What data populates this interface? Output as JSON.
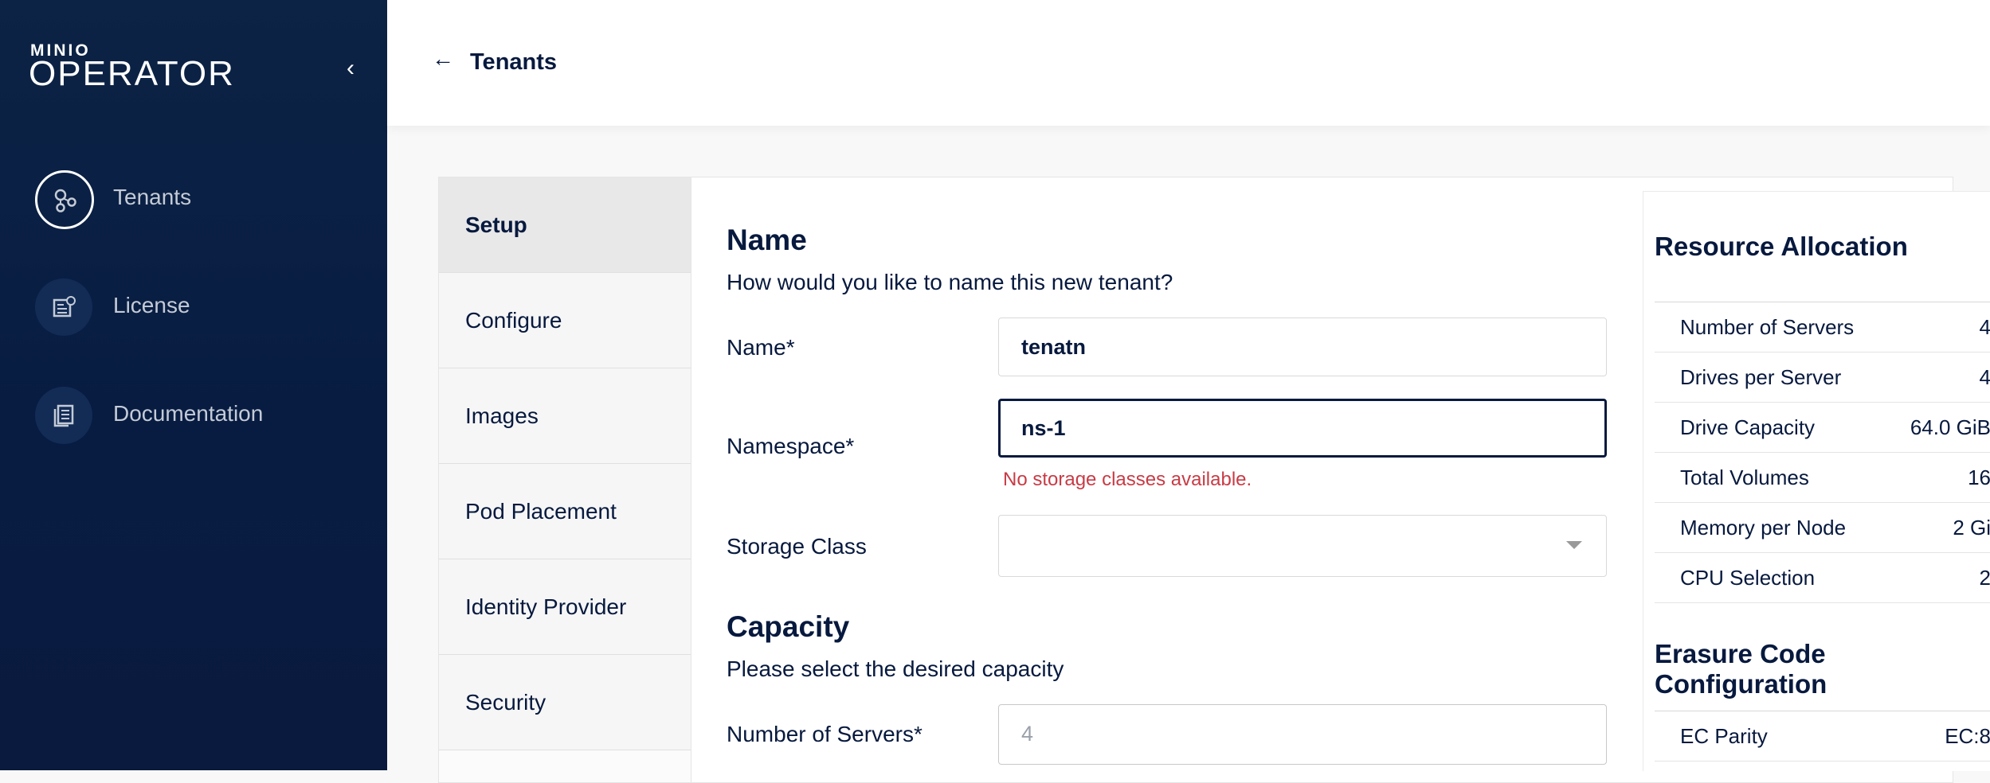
{
  "sidebar": {
    "logo_top": "MINIO",
    "logo_main": "OPERATOR",
    "items": [
      {
        "label": "Tenants",
        "icon": "tenants-icon"
      },
      {
        "label": "License",
        "icon": "license-icon"
      },
      {
        "label": "Documentation",
        "icon": "documentation-icon"
      }
    ]
  },
  "header": {
    "back_label": "Tenants"
  },
  "steps": [
    "Setup",
    "Configure",
    "Images",
    "Pod Placement",
    "Identity Provider",
    "Security"
  ],
  "name_section": {
    "title": "Name",
    "subtitle": "How would you like to name this new tenant?",
    "name_label": "Name*",
    "name_value": "tenatn",
    "namespace_label": "Namespace*",
    "namespace_value": "ns-1",
    "namespace_error": "No storage classes available.",
    "storage_class_label": "Storage Class",
    "storage_class_value": ""
  },
  "capacity_section": {
    "title": "Capacity",
    "subtitle": "Please select the desired capacity",
    "servers_label": "Number of Servers*",
    "servers_placeholder": "4"
  },
  "resource_allocation": {
    "title": "Resource Allocation",
    "rows": [
      {
        "key": "Number of Servers",
        "value": "4"
      },
      {
        "key": "Drives per Server",
        "value": "4"
      },
      {
        "key": "Drive Capacity",
        "value": "64.0 GiB"
      },
      {
        "key": "Total Volumes",
        "value": "16"
      },
      {
        "key": "Memory per Node",
        "value": "2 Gi"
      },
      {
        "key": "CPU Selection",
        "value": "2"
      }
    ]
  },
  "erasure_code": {
    "title": "Erasure Code Configuration",
    "rows": [
      {
        "key": "EC Parity",
        "value": "EC:8"
      }
    ]
  },
  "colors": {
    "sidebar_bg": "#081c42",
    "text": "#07193e",
    "error": "#c83b45"
  }
}
